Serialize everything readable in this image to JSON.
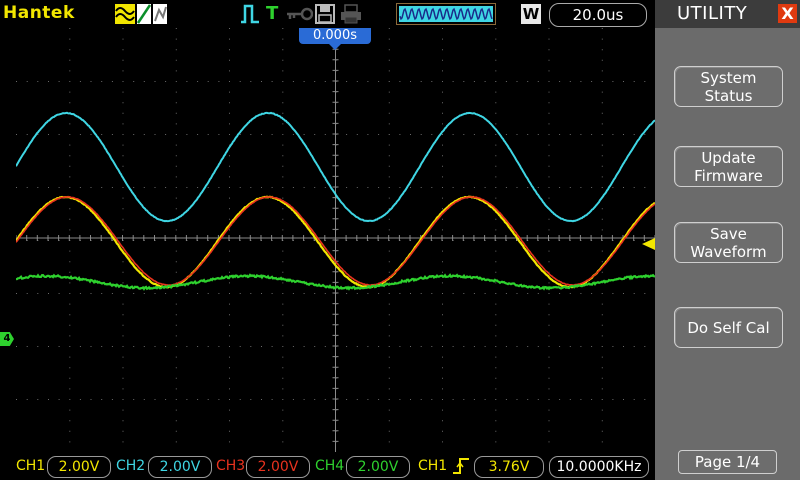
{
  "app": {
    "brand": "Hantek"
  },
  "topbar": {
    "timebase": "20.0us",
    "window_label": "W",
    "icons": [
      "waveform-mode-icon",
      "trigger-slope-icon",
      "persistence-icon",
      "pulse-icon",
      "trig-T-icon",
      "key-icon",
      "save-icon",
      "print-icon",
      "memory-waveform-icon"
    ]
  },
  "plot": {
    "trigger_position": "0.000s",
    "ch4_ground_marker": "4",
    "colors": {
      "ch1": "#f2e600",
      "ch2": "#3fd6e4",
      "ch3": "#e8321e",
      "ch4": "#2ed12e"
    }
  },
  "menu": {
    "title": "UTILITY",
    "close": "X",
    "buttons": [
      {
        "label": "System\nStatus"
      },
      {
        "label": "Update\nFirmware"
      },
      {
        "label": "Save\nWaveform"
      },
      {
        "label": "Do Self Cal"
      }
    ],
    "page": "Page 1/4"
  },
  "bottom": {
    "ch1": {
      "label": "CH1",
      "volts": "2.00V"
    },
    "ch2": {
      "label": "CH2",
      "volts": "2.00V"
    },
    "ch3": {
      "label": "CH3",
      "volts": "2.00V"
    },
    "ch4": {
      "label": "CH4",
      "volts": "2.00V"
    },
    "trigger": {
      "source": "CH1",
      "level": "3.76V",
      "frequency": "10.0000KHz"
    }
  }
}
